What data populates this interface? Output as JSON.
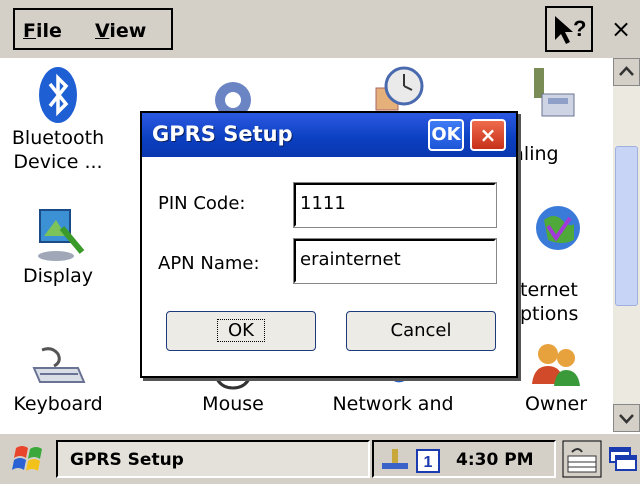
{
  "menu": {
    "file": "File",
    "file_rest": "ile",
    "file_key": "F",
    "view": "View",
    "view_key": "V",
    "view_rest": "iew"
  },
  "help_icon": "help-icon",
  "close_symbol": "×",
  "control_panel": {
    "items": [
      {
        "label_lines": [
          "Bluetooth",
          "Device ..."
        ],
        "icon": "bluetooth-icon"
      },
      {
        "label_lines": [
          "Dialing"
        ],
        "icon": "dialing-icon"
      },
      {
        "label_lines": [
          "Display"
        ],
        "icon": "display-icon"
      },
      {
        "label_lines": [
          "Internet",
          "Options"
        ],
        "icon": "internet-options-icon"
      },
      {
        "label_lines": [
          "Keyboard"
        ],
        "icon": "keyboard-icon"
      },
      {
        "label_lines": [
          "Mouse"
        ],
        "icon": "mouse-icon"
      },
      {
        "label_lines": [
          "Network and"
        ],
        "icon": "network-icon"
      },
      {
        "label_lines": [
          "Owner"
        ],
        "icon": "owner-icon"
      }
    ],
    "visible": {
      "bluetooth_1": "Bluetooth",
      "bluetooth_2": "Device ...",
      "dialing": "ialing",
      "display": "Display",
      "internet_1": "ternet",
      "internet_2": "ptions",
      "keyboard": "Keyboard",
      "mouse": "Mouse",
      "network": "Network and",
      "owner": "Owner"
    }
  },
  "dialog": {
    "title": "GPRS Setup",
    "ok_title_button": "OK",
    "close_button": "×",
    "pin_label": "PIN Code:",
    "pin_value": "1111",
    "apn_label": "APN Name:",
    "apn_value": "erainternet",
    "ok_button": "OK",
    "cancel_button": "Cancel"
  },
  "taskbar": {
    "task_label": "GPRS Setup",
    "input_indicator": "1",
    "clock": "4:30 PM"
  },
  "colors": {
    "title_bar": "#0a3fc0",
    "chrome": "#d4d0c8",
    "close_red": "#d9442a"
  }
}
